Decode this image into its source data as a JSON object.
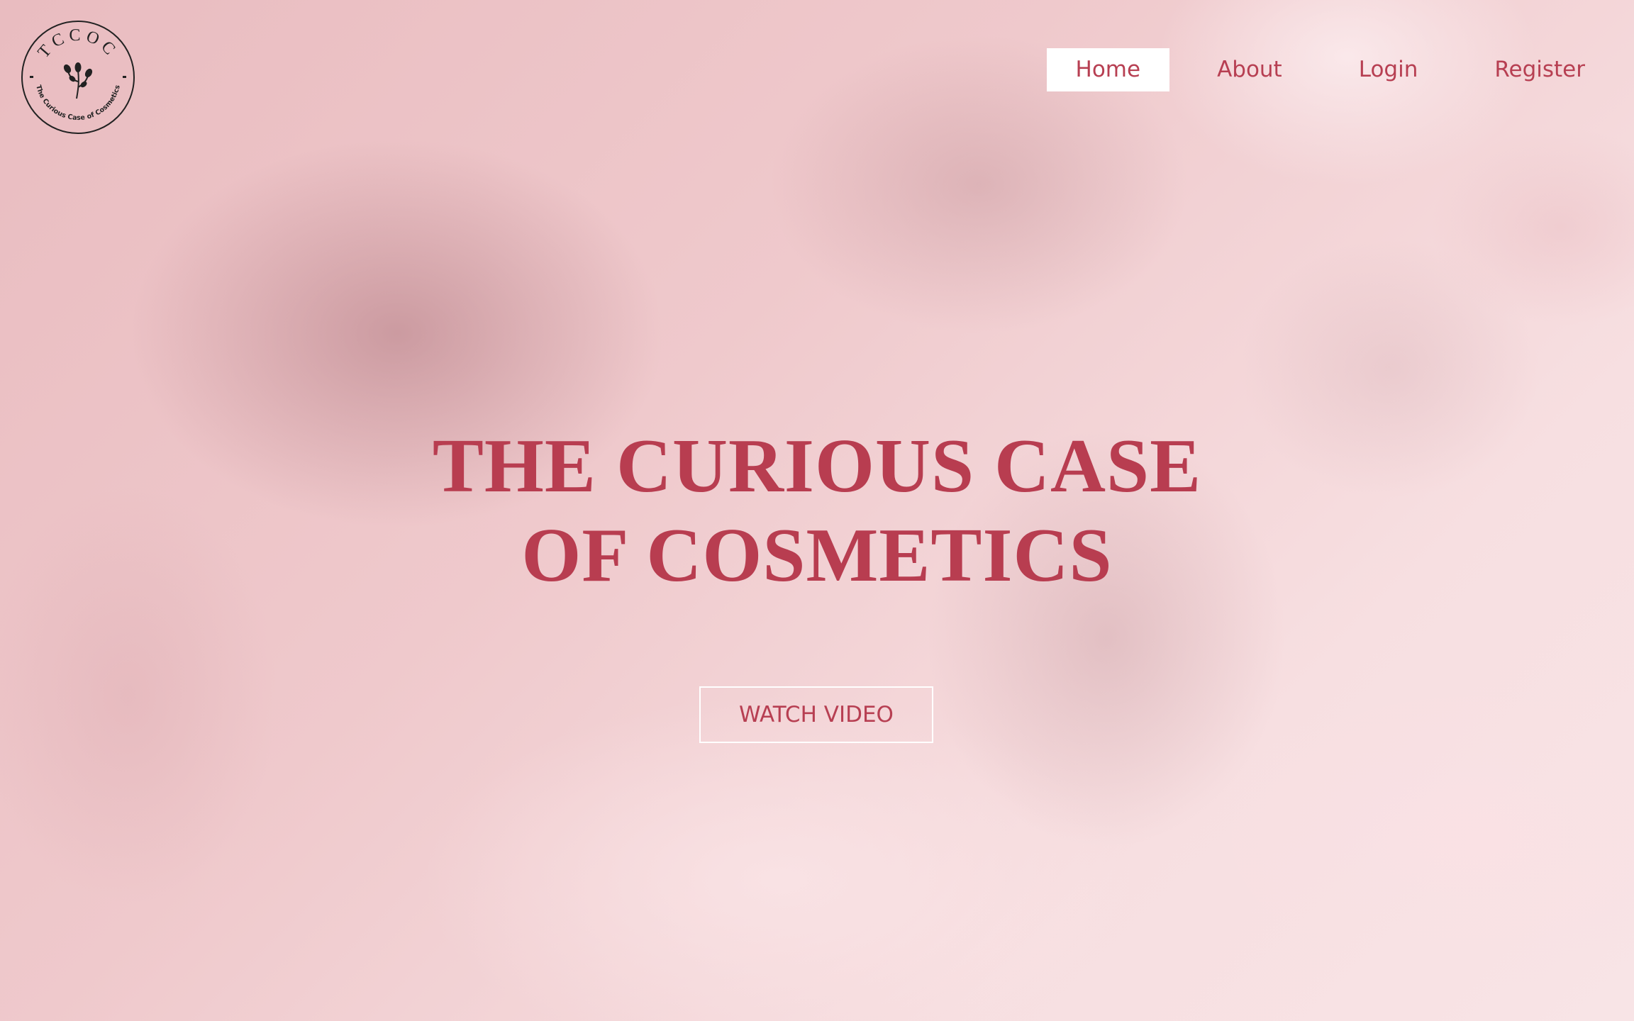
{
  "logo": {
    "monogram": "TCCOC",
    "tagline": "The Curious Case of Cosmetics",
    "icon": "flower-branch-icon"
  },
  "nav": {
    "items": [
      {
        "label": "Home",
        "active": true
      },
      {
        "label": "About",
        "active": false
      },
      {
        "label": "Login",
        "active": false
      },
      {
        "label": "Register",
        "active": false
      }
    ]
  },
  "hero": {
    "title_line1": "THE CURIOUS CASE",
    "title_line2": "OF COSMETICS",
    "button_label": "WATCH VIDEO"
  },
  "colors": {
    "accent": "#b83d50",
    "nav_active_bg": "#ffffff",
    "background": "#f3cfd1"
  }
}
